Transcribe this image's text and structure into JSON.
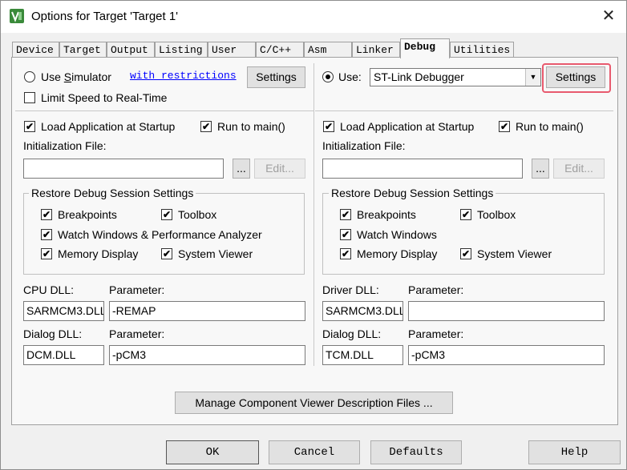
{
  "window": {
    "title": "Options for Target 'Target 1'"
  },
  "tabs": [
    "Device",
    "Target",
    "Output",
    "Listing",
    "User",
    "C/C++",
    "Asm",
    "Linker",
    "Debug",
    "Utilities"
  ],
  "left": {
    "use_simulator_pre": "Use ",
    "use_simulator_u": "S",
    "use_simulator_post": "imulator",
    "restrictions_link": "with restrictions",
    "settings_button": "Settings",
    "limit_speed": "Limit Speed to Real-Time",
    "load_app": "Load Application at Startup",
    "run_to_main": "Run to main()",
    "init_file_label": "Initialization File:",
    "init_file_value": "",
    "browse_button": "...",
    "edit_button": "Edit...",
    "restore_group": "Restore Debug Session Settings",
    "breakpoints": "Breakpoints",
    "toolbox": "Toolbox",
    "watch_windows": "Watch Windows & Performance Analyzer",
    "memory_display": "Memory Display",
    "system_viewer": "System Viewer",
    "cpu_dll_label": "CPU DLL:",
    "cpu_param_label": "Parameter:",
    "cpu_dll_value": "SARMCM3.DLL",
    "cpu_param_value": "-REMAP",
    "dialog_dll_label": "Dialog DLL:",
    "dialog_param_label": "Parameter:",
    "dialog_dll_value": "DCM.DLL",
    "dialog_param_value": "-pCM3"
  },
  "right": {
    "use_label": "Use:",
    "debugger_select": "ST-Link Debugger",
    "settings_button": "Settings",
    "load_app": "Load Application at Startup",
    "run_to_main": "Run to main()",
    "init_file_label": "Initialization File:",
    "init_file_value": "",
    "browse_button": "...",
    "edit_button": "Edit...",
    "restore_group": "Restore Debug Session Settings",
    "breakpoints": "Breakpoints",
    "toolbox": "Toolbox",
    "watch_windows": "Watch Windows",
    "memory_display": "Memory Display",
    "system_viewer": "System Viewer",
    "driver_dll_label": "Driver DLL:",
    "driver_param_label": "Parameter:",
    "driver_dll_value": "SARMCM3.DLL",
    "driver_param_value": "",
    "dialog_dll_label": "Dialog DLL:",
    "dialog_param_label": "Parameter:",
    "dialog_dll_value": "TCM.DLL",
    "dialog_param_value": "-pCM3"
  },
  "manage_button": "Manage Component Viewer Description Files ...",
  "footer": {
    "ok": "OK",
    "cancel": "Cancel",
    "defaults": "Defaults",
    "help": "Help"
  },
  "checkmark": "✔",
  "close_glyph": "✕",
  "dropdown_glyph": "▼",
  "accent_highlight": "#e85a6e"
}
